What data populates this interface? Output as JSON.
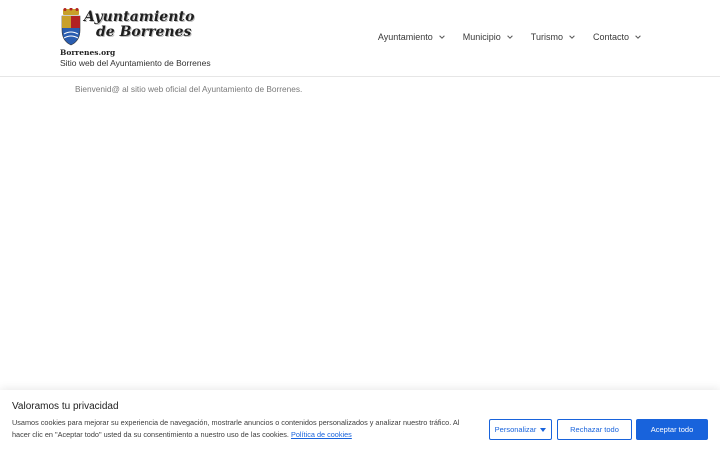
{
  "header": {
    "logo": {
      "line1": "Ayuntamiento",
      "line2": "de Borrenes",
      "domain": "Borrenes.org"
    },
    "tagline": "Sitio web del Ayuntamiento de Borrenes",
    "nav": [
      {
        "label": "Ayuntamiento",
        "icon": "chevron-down-icon"
      },
      {
        "label": "Municipio",
        "icon": "chevron-down-icon"
      },
      {
        "label": "Turismo",
        "icon": "chevron-down-icon"
      },
      {
        "label": "Contacto",
        "icon": "chevron-down-icon"
      }
    ]
  },
  "main": {
    "welcome": "Bienvenid@ al sitio web oficial del Ayuntamiento de Borrenes."
  },
  "cookie_banner": {
    "title": "Valoramos tu privacidad",
    "text": "Usamos cookies para mejorar su experiencia de navegación, mostrarle anuncios o contenidos personalizados y analizar nuestro tráfico. Al hacer clic en \"Aceptar todo\" usted da su consentimiento a nuestro uso de las cookies.",
    "policy_link": "Política de cookies",
    "customize_label": "Personalizar",
    "reject_label": "Rechazar todo",
    "accept_label": "Aceptar todo",
    "accent_color": "#1863dc"
  }
}
